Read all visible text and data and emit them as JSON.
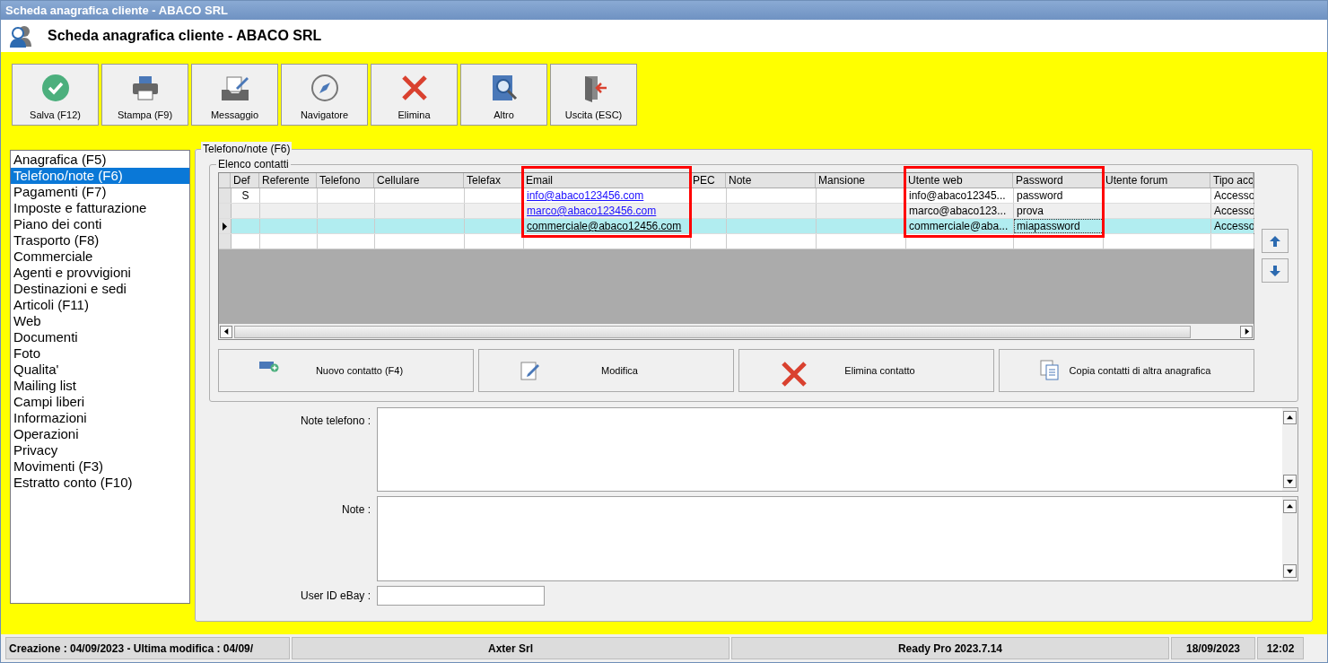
{
  "window": {
    "title": "Scheda anagrafica cliente - ABACO SRL"
  },
  "header": {
    "title": "Scheda anagrafica cliente - ABACO SRL"
  },
  "toolbar": [
    {
      "kind": "check",
      "label": "Salva (F12)"
    },
    {
      "kind": "printer",
      "label": "Stampa (F9)"
    },
    {
      "kind": "message",
      "label": "Messaggio"
    },
    {
      "kind": "compass",
      "label": "Navigatore"
    },
    {
      "kind": "delete",
      "label": "Elimina"
    },
    {
      "kind": "search",
      "label": "Altro"
    },
    {
      "kind": "exit",
      "label": "Uscita (ESC)"
    }
  ],
  "sidebar": {
    "items": [
      {
        "label": "Anagrafica (F5)",
        "selected": false
      },
      {
        "label": "Telefono/note (F6)",
        "selected": true
      },
      {
        "label": "Pagamenti (F7)",
        "selected": false
      },
      {
        "label": "Imposte e fatturazione",
        "selected": false
      },
      {
        "label": "Piano dei conti",
        "selected": false
      },
      {
        "label": "Trasporto (F8)",
        "selected": false
      },
      {
        "label": "Commerciale",
        "selected": false
      },
      {
        "label": "Agenti e provvigioni",
        "selected": false
      },
      {
        "label": "Destinazioni e sedi",
        "selected": false
      },
      {
        "label": "Articoli (F11)",
        "selected": false
      },
      {
        "label": "Web",
        "selected": false
      },
      {
        "label": "Documenti",
        "selected": false
      },
      {
        "label": "Foto",
        "selected": false
      },
      {
        "label": "Qualita'",
        "selected": false
      },
      {
        "label": "Mailing list",
        "selected": false
      },
      {
        "label": "Campi liberi",
        "selected": false
      },
      {
        "label": "Informazioni",
        "selected": false
      },
      {
        "label": "Operazioni",
        "selected": false
      },
      {
        "label": "Privacy",
        "selected": false
      },
      {
        "label": "Movimenti (F3)",
        "selected": false
      },
      {
        "label": "Estratto conto (F10)",
        "selected": false
      }
    ]
  },
  "panel": {
    "title": "Telefono/note (F6)",
    "contacts": {
      "title": "Elenco contatti",
      "columns": [
        {
          "label": "Def",
          "kind": "center",
          "highlighted": false,
          "focused": false
        },
        {
          "label": "Referente",
          "kind": "text",
          "highlighted": false,
          "focused": false
        },
        {
          "label": "Telefono",
          "kind": "text",
          "highlighted": false,
          "focused": false
        },
        {
          "label": "Cellulare",
          "kind": "text",
          "highlighted": false,
          "focused": false
        },
        {
          "label": "Telefax",
          "kind": "text",
          "highlighted": false,
          "focused": false
        },
        {
          "label": "Email",
          "kind": "link",
          "highlighted": true,
          "focused": false
        },
        {
          "label": "PEC",
          "kind": "text",
          "highlighted": false,
          "focused": false
        },
        {
          "label": "Note",
          "kind": "text",
          "highlighted": false,
          "focused": false
        },
        {
          "label": "Mansione",
          "kind": "text",
          "highlighted": false,
          "focused": false
        },
        {
          "label": "Utente web",
          "kind": "text",
          "highlighted": true,
          "focused": false
        },
        {
          "label": "Password",
          "kind": "text",
          "highlighted": true,
          "focused": true
        },
        {
          "label": "Utente forum",
          "kind": "text",
          "highlighted": false,
          "focused": false
        },
        {
          "label": "Tipo acc",
          "kind": "text",
          "highlighted": false,
          "focused": false
        }
      ],
      "rows": [
        {
          "selected": false,
          "cells": [
            "S",
            null,
            null,
            null,
            null,
            "info@abaco123456.com",
            null,
            null,
            null,
            "info@abaco12345...",
            "password",
            null,
            "Accesso"
          ]
        },
        {
          "selected": false,
          "cells": [
            null,
            null,
            null,
            null,
            null,
            "marco@abaco123456.com",
            null,
            null,
            null,
            "marco@abaco123...",
            "prova",
            null,
            "Accesso"
          ]
        },
        {
          "selected": true,
          "cells": [
            null,
            null,
            null,
            null,
            null,
            "commerciale@abaco12456.com",
            null,
            null,
            null,
            "commerciale@aba...",
            "miapassword",
            null,
            "Accesso"
          ]
        }
      ],
      "buttons": [
        {
          "kind": "add",
          "label": "Nuovo contatto (F4)"
        },
        {
          "kind": "edit",
          "label": "Modifica"
        },
        {
          "kind": "delete",
          "label": "Elimina contatto"
        },
        {
          "kind": "copy",
          "label": "Copia contatti di altra anagrafica"
        }
      ]
    },
    "note_telefono": {
      "label": "Note telefono :"
    },
    "note": {
      "label": "Note :"
    },
    "ebay": {
      "label": "User ID eBay :"
    }
  },
  "status_bar": [
    "Creazione : 04/09/2023 - Ultima modifica : 04/09/",
    "Axter Srl",
    "Ready Pro 2023.7.14",
    "18/09/2023",
    "12:02"
  ]
}
